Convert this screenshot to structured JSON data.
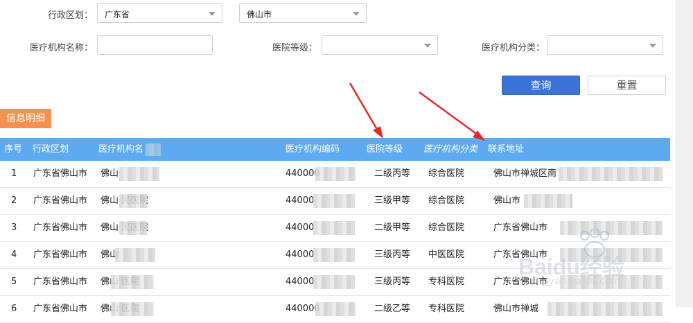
{
  "filters": {
    "region_label": "行政区划：",
    "province_value": "广东省",
    "city_value": "佛山市",
    "name_label": "医疗机构名称：",
    "name_value": "",
    "level_label": "医院等级：",
    "level_value": "",
    "category_label": "医疗机构分类：",
    "category_value": ""
  },
  "buttons": {
    "query": "查询",
    "reset": "重置"
  },
  "section_title": "信息明细",
  "table": {
    "headers": [
      "序号",
      "行政区划",
      "医疗机构名",
      "医疗机构编码",
      "医院等级",
      "医疗机构分类",
      "联系地址"
    ],
    "rows": [
      {
        "no": "1",
        "region": "广东省佛山市",
        "name": "佛山",
        "code": "440000",
        "level": "二级丙等",
        "category": "综合医院",
        "address": "佛山市禅城区南"
      },
      {
        "no": "2",
        "region": "广东省佛山市",
        "name": "佛山        民医院",
        "code": "44000",
        "level": "三级甲等",
        "category": "综合医院",
        "address": "佛山市"
      },
      {
        "no": "3",
        "region": "广东省佛山市",
        "name": "佛山        民医院",
        "code": "44000",
        "level": "二级甲等",
        "category": "综合医院",
        "address": "广东省佛山市"
      },
      {
        "no": "4",
        "region": "广东省佛山市",
        "name": "佛山",
        "code": "44000",
        "level": "三级丙等",
        "category": "中医医院",
        "address": "广东省佛山市"
      },
      {
        "no": "5",
        "region": "广东省佛山市",
        "name": "佛山        医院",
        "code": "44000",
        "level": "三级丙等",
        "category": "专科医院",
        "address": "广东省佛山市"
      },
      {
        "no": "6",
        "region": "广东省佛山市",
        "name": "佛山        医院",
        "code": "440000",
        "level": "二级乙等",
        "category": "专科医院",
        "address": "佛山市禅城"
      }
    ]
  },
  "watermark": {
    "brand": "Baidu经验",
    "url": "jingyan.baidu.com"
  },
  "colors": {
    "header_blue": "#5eaaf0",
    "primary_button": "#3b74d6",
    "section_tag": "#f5914e",
    "annotation_arrow": "#e8262a"
  }
}
